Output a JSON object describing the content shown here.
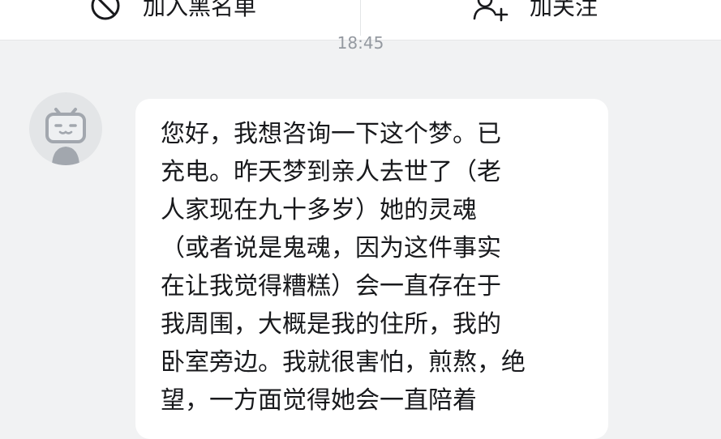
{
  "header": {
    "block_label": "加入黑名单",
    "block_icon": "block-icon",
    "follow_label": "加关注",
    "follow_icon": "add-user-icon"
  },
  "chat": {
    "timestamp": "18:45",
    "messages": [
      {
        "sender": "other",
        "avatar_icon": "bilibili-tv-mascot-icon",
        "text": "您好，我想咨询一下这个梦。已\n充电。昨天梦到亲人去世了（老\n人家现在九十多岁）她的灵魂\n（或者说是鬼魂，因为这件事实\n在让我觉得糟糕）会一直存在于\n我周围，大概是我的住所，我的\n卧室旁边。我就很害怕，煎熬，绝\n望，一方面觉得她会一直陪着"
      }
    ]
  },
  "colors": {
    "background": "#f1f2f3",
    "bubble": "#ffffff",
    "text": "#18191c",
    "muted": "#9499a0",
    "avatar_bg": "#e3e5e7",
    "mascot": "#a2a7ae"
  }
}
